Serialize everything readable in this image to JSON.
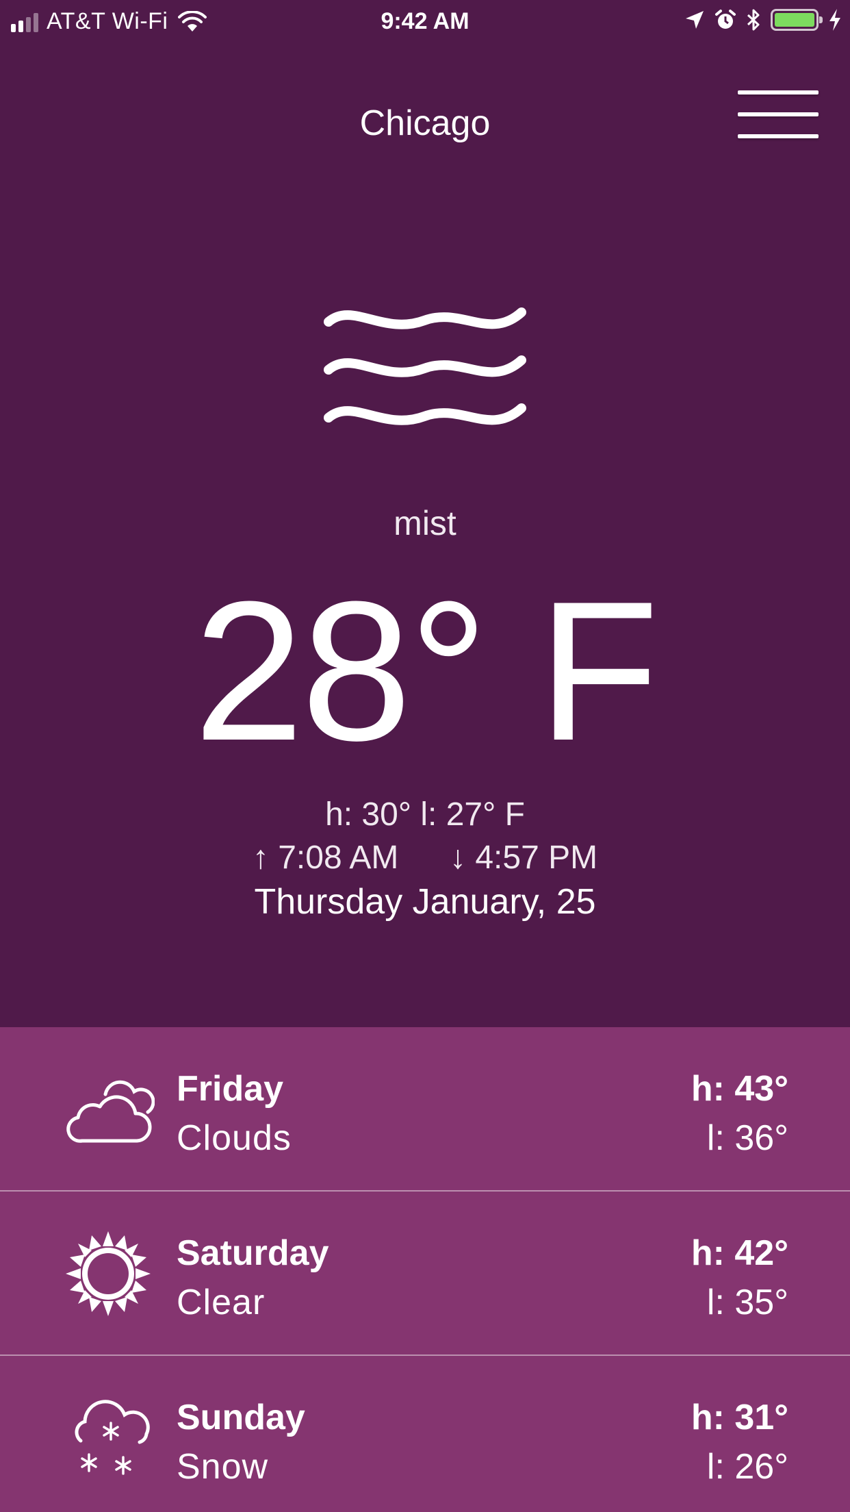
{
  "status_bar": {
    "carrier": "AT&T Wi-Fi",
    "time": "9:42 AM",
    "battery_color": "#7ddb5f"
  },
  "header": {
    "city": "Chicago",
    "menu_icon": "hamburger-menu-icon"
  },
  "current": {
    "icon": "mist-icon",
    "condition": "mist",
    "temperature": "28° F",
    "high_low": "h: 30°   l: 27° F",
    "sunrise": "7:08 AM",
    "sunset": "4:57 PM",
    "date": "Thursday January, 25"
  },
  "forecast": [
    {
      "day": "Friday",
      "condition": "Clouds",
      "high": "h: 43°",
      "low": "l: 36°",
      "icon": "clouds-icon"
    },
    {
      "day": "Saturday",
      "condition": "Clear",
      "high": "h: 42°",
      "low": "l: 35°",
      "icon": "clear-sun-icon"
    },
    {
      "day": "Sunday",
      "condition": "Snow",
      "high": "h: 31°",
      "low": "l: 26°",
      "icon": "snow-icon"
    }
  ],
  "colors": {
    "background": "#501a4a",
    "forecast_background": "#853570",
    "text": "#ffffff"
  }
}
